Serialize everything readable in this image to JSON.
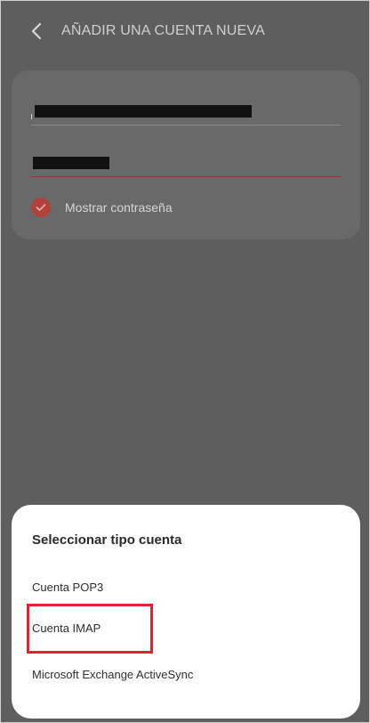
{
  "header": {
    "title": "AÑADIR UNA CUENTA NUEVA",
    "back_icon": "chevron-left-icon"
  },
  "form": {
    "email_value": "",
    "password_value": "",
    "show_password_label": "Mostrar contraseña",
    "show_password_checked": true,
    "accent_color": "#b0423a"
  },
  "sheet": {
    "title": "Seleccionar tipo cuenta",
    "options": [
      {
        "label": "Cuenta POP3"
      },
      {
        "label": "Cuenta IMAP",
        "highlighted": true
      },
      {
        "label": "Microsoft Exchange ActiveSync"
      }
    ],
    "highlight_color": "#e0242f"
  }
}
